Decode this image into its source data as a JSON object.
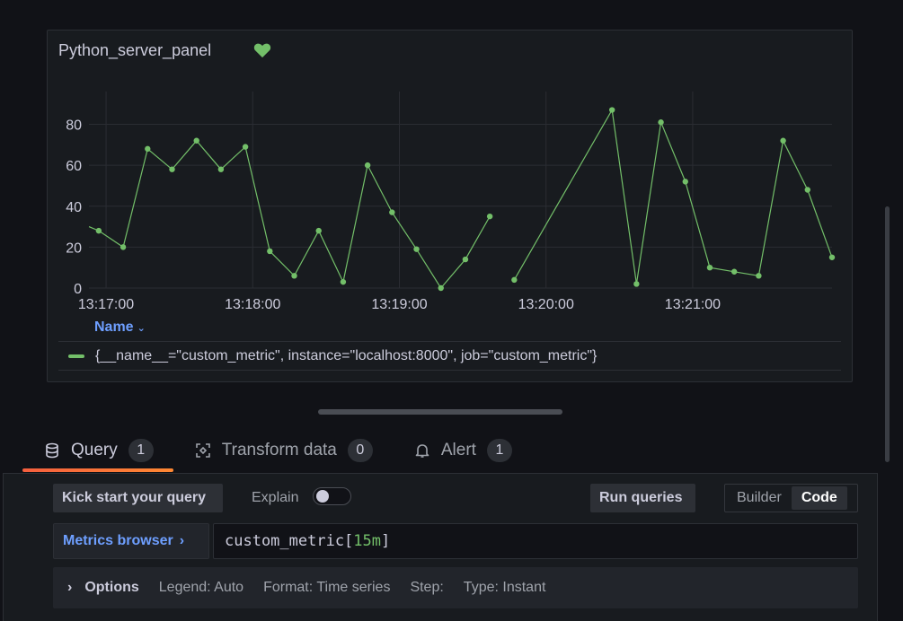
{
  "panel": {
    "title": "Python_server_panel",
    "legend_header": "Name",
    "legend_entry": "{__name__=\"custom_metric\", instance=\"localhost:8000\", job=\"custom_metric\"}"
  },
  "chart_data": {
    "type": "line",
    "x_ticks": [
      "13:17:00",
      "13:18:00",
      "13:19:00",
      "13:20:00",
      "13:21:00"
    ],
    "y_ticks": [
      0,
      20,
      40,
      60,
      80
    ],
    "ylim": [
      0,
      96
    ],
    "series": [
      {
        "name": "{__name__=\"custom_metric\", instance=\"localhost:8000\", job=\"custom_metric\"}",
        "color": "#73bf69",
        "x_seconds_after_13_17_00": [
          -7,
          -3,
          7,
          17,
          27,
          37,
          47,
          57,
          67,
          77,
          87,
          97,
          107,
          117,
          127,
          137,
          147,
          157,
          167,
          207,
          217,
          227,
          237,
          247,
          257,
          267,
          277,
          287,
          297
        ],
        "values": [
          30,
          28,
          20,
          68,
          58,
          72,
          58,
          69,
          18,
          6,
          28,
          3,
          60,
          37,
          19,
          0,
          14,
          35,
          null,
          4,
          87,
          2,
          81,
          52,
          10,
          8,
          6,
          72,
          48,
          15
        ]
      }
    ],
    "x_range_seconds": [
      -7,
      297
    ],
    "grid": true
  },
  "tabs": [
    {
      "label": "Query",
      "count": "1",
      "icon": "database-icon"
    },
    {
      "label": "Transform data",
      "count": "0",
      "icon": "transform-icon"
    },
    {
      "label": "Alert",
      "count": "1",
      "icon": "bell-icon"
    }
  ],
  "editor": {
    "kick_start_label": "Kick start your query",
    "explain_label": "Explain",
    "run_queries_label": "Run queries",
    "mode_builder": "Builder",
    "mode_code": "Code",
    "metrics_browser_label": "Metrics browser",
    "query_prefix": "custom_metric[",
    "query_range": "15m",
    "query_suffix": "]"
  },
  "options": {
    "title": "Options",
    "legend": "Legend: Auto",
    "format": "Format: Time series",
    "step": "Step:",
    "type": "Type: Instant"
  }
}
